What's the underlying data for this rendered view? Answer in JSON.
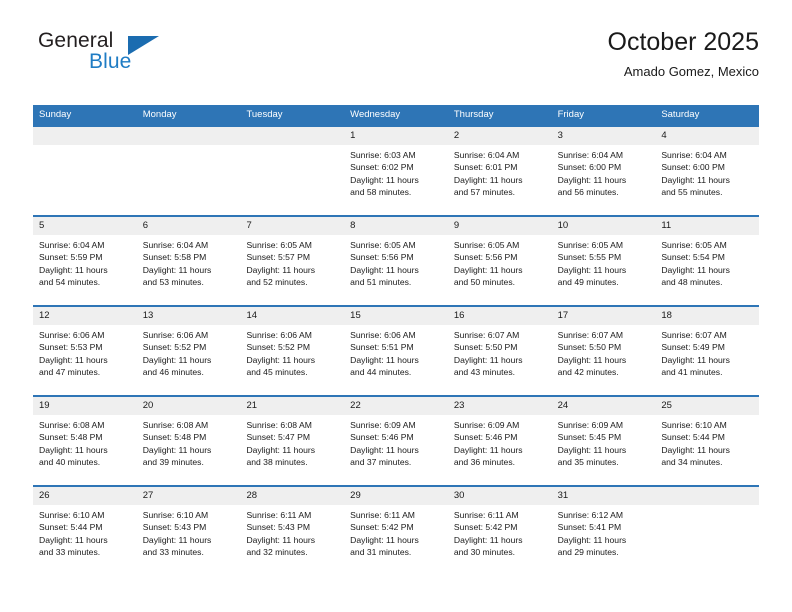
{
  "brand": {
    "name_part1": "General",
    "name_part2": "Blue",
    "accent_color": "#1b6cb0"
  },
  "header": {
    "title": "October 2025",
    "subtitle": "Amado Gomez, Mexico"
  },
  "calendar": {
    "header_bg": "#2e75b6",
    "day_band_bg": "#efefef",
    "weekdays": [
      "Sunday",
      "Monday",
      "Tuesday",
      "Wednesday",
      "Thursday",
      "Friday",
      "Saturday"
    ],
    "weeks": [
      [
        {
          "day": "",
          "sunrise": "",
          "sunset": "",
          "daylight": "",
          "daylight2": ""
        },
        {
          "day": "",
          "sunrise": "",
          "sunset": "",
          "daylight": "",
          "daylight2": ""
        },
        {
          "day": "",
          "sunrise": "",
          "sunset": "",
          "daylight": "",
          "daylight2": ""
        },
        {
          "day": "1",
          "sunrise": "Sunrise: 6:03 AM",
          "sunset": "Sunset: 6:02 PM",
          "daylight": "Daylight: 11 hours",
          "daylight2": "and 58 minutes."
        },
        {
          "day": "2",
          "sunrise": "Sunrise: 6:04 AM",
          "sunset": "Sunset: 6:01 PM",
          "daylight": "Daylight: 11 hours",
          "daylight2": "and 57 minutes."
        },
        {
          "day": "3",
          "sunrise": "Sunrise: 6:04 AM",
          "sunset": "Sunset: 6:00 PM",
          "daylight": "Daylight: 11 hours",
          "daylight2": "and 56 minutes."
        },
        {
          "day": "4",
          "sunrise": "Sunrise: 6:04 AM",
          "sunset": "Sunset: 6:00 PM",
          "daylight": "Daylight: 11 hours",
          "daylight2": "and 55 minutes."
        }
      ],
      [
        {
          "day": "5",
          "sunrise": "Sunrise: 6:04 AM",
          "sunset": "Sunset: 5:59 PM",
          "daylight": "Daylight: 11 hours",
          "daylight2": "and 54 minutes."
        },
        {
          "day": "6",
          "sunrise": "Sunrise: 6:04 AM",
          "sunset": "Sunset: 5:58 PM",
          "daylight": "Daylight: 11 hours",
          "daylight2": "and 53 minutes."
        },
        {
          "day": "7",
          "sunrise": "Sunrise: 6:05 AM",
          "sunset": "Sunset: 5:57 PM",
          "daylight": "Daylight: 11 hours",
          "daylight2": "and 52 minutes."
        },
        {
          "day": "8",
          "sunrise": "Sunrise: 6:05 AM",
          "sunset": "Sunset: 5:56 PM",
          "daylight": "Daylight: 11 hours",
          "daylight2": "and 51 minutes."
        },
        {
          "day": "9",
          "sunrise": "Sunrise: 6:05 AM",
          "sunset": "Sunset: 5:56 PM",
          "daylight": "Daylight: 11 hours",
          "daylight2": "and 50 minutes."
        },
        {
          "day": "10",
          "sunrise": "Sunrise: 6:05 AM",
          "sunset": "Sunset: 5:55 PM",
          "daylight": "Daylight: 11 hours",
          "daylight2": "and 49 minutes."
        },
        {
          "day": "11",
          "sunrise": "Sunrise: 6:05 AM",
          "sunset": "Sunset: 5:54 PM",
          "daylight": "Daylight: 11 hours",
          "daylight2": "and 48 minutes."
        }
      ],
      [
        {
          "day": "12",
          "sunrise": "Sunrise: 6:06 AM",
          "sunset": "Sunset: 5:53 PM",
          "daylight": "Daylight: 11 hours",
          "daylight2": "and 47 minutes."
        },
        {
          "day": "13",
          "sunrise": "Sunrise: 6:06 AM",
          "sunset": "Sunset: 5:52 PM",
          "daylight": "Daylight: 11 hours",
          "daylight2": "and 46 minutes."
        },
        {
          "day": "14",
          "sunrise": "Sunrise: 6:06 AM",
          "sunset": "Sunset: 5:52 PM",
          "daylight": "Daylight: 11 hours",
          "daylight2": "and 45 minutes."
        },
        {
          "day": "15",
          "sunrise": "Sunrise: 6:06 AM",
          "sunset": "Sunset: 5:51 PM",
          "daylight": "Daylight: 11 hours",
          "daylight2": "and 44 minutes."
        },
        {
          "day": "16",
          "sunrise": "Sunrise: 6:07 AM",
          "sunset": "Sunset: 5:50 PM",
          "daylight": "Daylight: 11 hours",
          "daylight2": "and 43 minutes."
        },
        {
          "day": "17",
          "sunrise": "Sunrise: 6:07 AM",
          "sunset": "Sunset: 5:50 PM",
          "daylight": "Daylight: 11 hours",
          "daylight2": "and 42 minutes."
        },
        {
          "day": "18",
          "sunrise": "Sunrise: 6:07 AM",
          "sunset": "Sunset: 5:49 PM",
          "daylight": "Daylight: 11 hours",
          "daylight2": "and 41 minutes."
        }
      ],
      [
        {
          "day": "19",
          "sunrise": "Sunrise: 6:08 AM",
          "sunset": "Sunset: 5:48 PM",
          "daylight": "Daylight: 11 hours",
          "daylight2": "and 40 minutes."
        },
        {
          "day": "20",
          "sunrise": "Sunrise: 6:08 AM",
          "sunset": "Sunset: 5:48 PM",
          "daylight": "Daylight: 11 hours",
          "daylight2": "and 39 minutes."
        },
        {
          "day": "21",
          "sunrise": "Sunrise: 6:08 AM",
          "sunset": "Sunset: 5:47 PM",
          "daylight": "Daylight: 11 hours",
          "daylight2": "and 38 minutes."
        },
        {
          "day": "22",
          "sunrise": "Sunrise: 6:09 AM",
          "sunset": "Sunset: 5:46 PM",
          "daylight": "Daylight: 11 hours",
          "daylight2": "and 37 minutes."
        },
        {
          "day": "23",
          "sunrise": "Sunrise: 6:09 AM",
          "sunset": "Sunset: 5:46 PM",
          "daylight": "Daylight: 11 hours",
          "daylight2": "and 36 minutes."
        },
        {
          "day": "24",
          "sunrise": "Sunrise: 6:09 AM",
          "sunset": "Sunset: 5:45 PM",
          "daylight": "Daylight: 11 hours",
          "daylight2": "and 35 minutes."
        },
        {
          "day": "25",
          "sunrise": "Sunrise: 6:10 AM",
          "sunset": "Sunset: 5:44 PM",
          "daylight": "Daylight: 11 hours",
          "daylight2": "and 34 minutes."
        }
      ],
      [
        {
          "day": "26",
          "sunrise": "Sunrise: 6:10 AM",
          "sunset": "Sunset: 5:44 PM",
          "daylight": "Daylight: 11 hours",
          "daylight2": "and 33 minutes."
        },
        {
          "day": "27",
          "sunrise": "Sunrise: 6:10 AM",
          "sunset": "Sunset: 5:43 PM",
          "daylight": "Daylight: 11 hours",
          "daylight2": "and 33 minutes."
        },
        {
          "day": "28",
          "sunrise": "Sunrise: 6:11 AM",
          "sunset": "Sunset: 5:43 PM",
          "daylight": "Daylight: 11 hours",
          "daylight2": "and 32 minutes."
        },
        {
          "day": "29",
          "sunrise": "Sunrise: 6:11 AM",
          "sunset": "Sunset: 5:42 PM",
          "daylight": "Daylight: 11 hours",
          "daylight2": "and 31 minutes."
        },
        {
          "day": "30",
          "sunrise": "Sunrise: 6:11 AM",
          "sunset": "Sunset: 5:42 PM",
          "daylight": "Daylight: 11 hours",
          "daylight2": "and 30 minutes."
        },
        {
          "day": "31",
          "sunrise": "Sunrise: 6:12 AM",
          "sunset": "Sunset: 5:41 PM",
          "daylight": "Daylight: 11 hours",
          "daylight2": "and 29 minutes."
        },
        {
          "day": "",
          "sunrise": "",
          "sunset": "",
          "daylight": "",
          "daylight2": ""
        }
      ]
    ]
  }
}
